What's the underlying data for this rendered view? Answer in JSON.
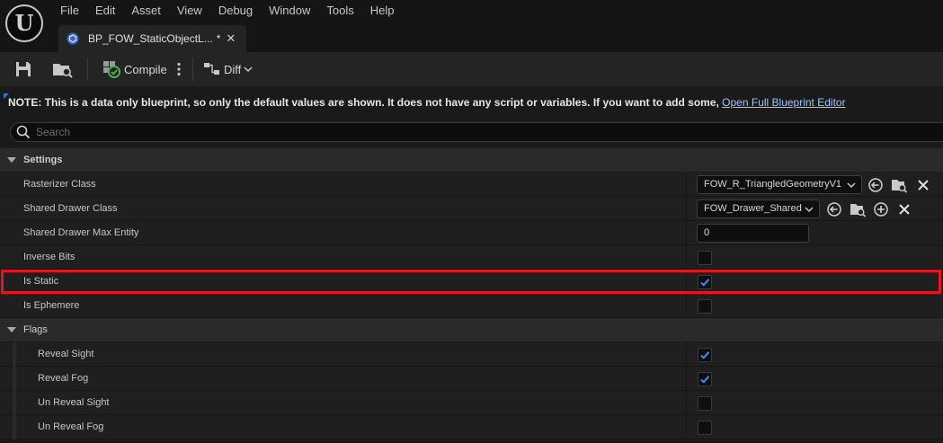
{
  "app": {
    "logo_glyph": "U"
  },
  "menu": [
    "File",
    "Edit",
    "Asset",
    "View",
    "Debug",
    "Window",
    "Tools",
    "Help"
  ],
  "tab": {
    "label": "BP_FOW_StaticObjectL...",
    "dirty_marker": "*",
    "close_glyph": "✕"
  },
  "toolbar": {
    "compile_label": "Compile",
    "diff_label": "Diff"
  },
  "note": {
    "text": "NOTE: This is a data only blueprint, so only the default values are shown.  It does not have any script or variables.  If you want to add some, ",
    "link": "Open Full Blueprint Editor"
  },
  "search": {
    "placeholder": "Search",
    "value": ""
  },
  "details": {
    "settings": {
      "label": "Settings",
      "rasterizer_class": {
        "label": "Rasterizer Class",
        "value": "FOW_R_TriangledGeometryV1"
      },
      "shared_drawer_class": {
        "label": "Shared Drawer Class",
        "value": "FOW_Drawer_Shared"
      },
      "shared_drawer_max_entity": {
        "label": "Shared Drawer Max Entity",
        "value": "0"
      },
      "inverse_bits": {
        "label": "Inverse Bits",
        "checked": false
      },
      "is_static": {
        "label": "Is Static",
        "checked": true,
        "highlighted": true
      },
      "is_ephemere": {
        "label": "Is Ephemere",
        "checked": false
      }
    },
    "flags": {
      "label": "Flags",
      "reveal_sight": {
        "label": "Reveal Sight",
        "checked": true
      },
      "reveal_fog": {
        "label": "Reveal Fog",
        "checked": true
      },
      "un_reveal_sight": {
        "label": "Un Reveal Sight",
        "checked": false
      },
      "un_reveal_fog": {
        "label": "Un Reveal Fog",
        "checked": false
      }
    }
  },
  "colors": {
    "accent": "#2a7bd8",
    "highlight": "#e3161f",
    "link": "#9fc4ff",
    "background": "#1a1a1a"
  }
}
